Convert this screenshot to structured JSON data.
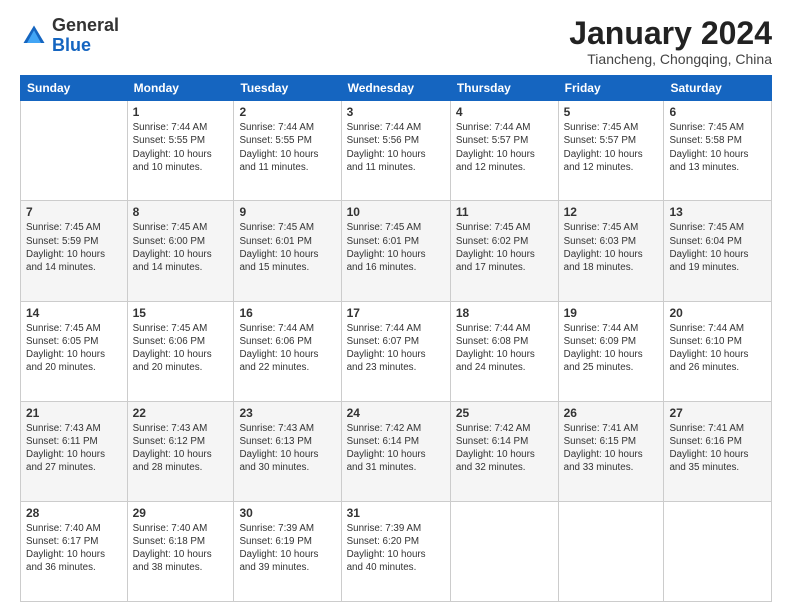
{
  "header": {
    "logo_general": "General",
    "logo_blue": "Blue",
    "month_title": "January 2024",
    "location": "Tiancheng, Chongqing, China"
  },
  "weekdays": [
    "Sunday",
    "Monday",
    "Tuesday",
    "Wednesday",
    "Thursday",
    "Friday",
    "Saturday"
  ],
  "weeks": [
    [
      {
        "day": "",
        "info": ""
      },
      {
        "day": "1",
        "info": "Sunrise: 7:44 AM\nSunset: 5:55 PM\nDaylight: 10 hours\nand 10 minutes."
      },
      {
        "day": "2",
        "info": "Sunrise: 7:44 AM\nSunset: 5:55 PM\nDaylight: 10 hours\nand 11 minutes."
      },
      {
        "day": "3",
        "info": "Sunrise: 7:44 AM\nSunset: 5:56 PM\nDaylight: 10 hours\nand 11 minutes."
      },
      {
        "day": "4",
        "info": "Sunrise: 7:44 AM\nSunset: 5:57 PM\nDaylight: 10 hours\nand 12 minutes."
      },
      {
        "day": "5",
        "info": "Sunrise: 7:45 AM\nSunset: 5:57 PM\nDaylight: 10 hours\nand 12 minutes."
      },
      {
        "day": "6",
        "info": "Sunrise: 7:45 AM\nSunset: 5:58 PM\nDaylight: 10 hours\nand 13 minutes."
      }
    ],
    [
      {
        "day": "7",
        "info": "Sunrise: 7:45 AM\nSunset: 5:59 PM\nDaylight: 10 hours\nand 14 minutes."
      },
      {
        "day": "8",
        "info": "Sunrise: 7:45 AM\nSunset: 6:00 PM\nDaylight: 10 hours\nand 14 minutes."
      },
      {
        "day": "9",
        "info": "Sunrise: 7:45 AM\nSunset: 6:01 PM\nDaylight: 10 hours\nand 15 minutes."
      },
      {
        "day": "10",
        "info": "Sunrise: 7:45 AM\nSunset: 6:01 PM\nDaylight: 10 hours\nand 16 minutes."
      },
      {
        "day": "11",
        "info": "Sunrise: 7:45 AM\nSunset: 6:02 PM\nDaylight: 10 hours\nand 17 minutes."
      },
      {
        "day": "12",
        "info": "Sunrise: 7:45 AM\nSunset: 6:03 PM\nDaylight: 10 hours\nand 18 minutes."
      },
      {
        "day": "13",
        "info": "Sunrise: 7:45 AM\nSunset: 6:04 PM\nDaylight: 10 hours\nand 19 minutes."
      }
    ],
    [
      {
        "day": "14",
        "info": "Sunrise: 7:45 AM\nSunset: 6:05 PM\nDaylight: 10 hours\nand 20 minutes."
      },
      {
        "day": "15",
        "info": "Sunrise: 7:45 AM\nSunset: 6:06 PM\nDaylight: 10 hours\nand 20 minutes."
      },
      {
        "day": "16",
        "info": "Sunrise: 7:44 AM\nSunset: 6:06 PM\nDaylight: 10 hours\nand 22 minutes."
      },
      {
        "day": "17",
        "info": "Sunrise: 7:44 AM\nSunset: 6:07 PM\nDaylight: 10 hours\nand 23 minutes."
      },
      {
        "day": "18",
        "info": "Sunrise: 7:44 AM\nSunset: 6:08 PM\nDaylight: 10 hours\nand 24 minutes."
      },
      {
        "day": "19",
        "info": "Sunrise: 7:44 AM\nSunset: 6:09 PM\nDaylight: 10 hours\nand 25 minutes."
      },
      {
        "day": "20",
        "info": "Sunrise: 7:44 AM\nSunset: 6:10 PM\nDaylight: 10 hours\nand 26 minutes."
      }
    ],
    [
      {
        "day": "21",
        "info": "Sunrise: 7:43 AM\nSunset: 6:11 PM\nDaylight: 10 hours\nand 27 minutes."
      },
      {
        "day": "22",
        "info": "Sunrise: 7:43 AM\nSunset: 6:12 PM\nDaylight: 10 hours\nand 28 minutes."
      },
      {
        "day": "23",
        "info": "Sunrise: 7:43 AM\nSunset: 6:13 PM\nDaylight: 10 hours\nand 30 minutes."
      },
      {
        "day": "24",
        "info": "Sunrise: 7:42 AM\nSunset: 6:14 PM\nDaylight: 10 hours\nand 31 minutes."
      },
      {
        "day": "25",
        "info": "Sunrise: 7:42 AM\nSunset: 6:14 PM\nDaylight: 10 hours\nand 32 minutes."
      },
      {
        "day": "26",
        "info": "Sunrise: 7:41 AM\nSunset: 6:15 PM\nDaylight: 10 hours\nand 33 minutes."
      },
      {
        "day": "27",
        "info": "Sunrise: 7:41 AM\nSunset: 6:16 PM\nDaylight: 10 hours\nand 35 minutes."
      }
    ],
    [
      {
        "day": "28",
        "info": "Sunrise: 7:40 AM\nSunset: 6:17 PM\nDaylight: 10 hours\nand 36 minutes."
      },
      {
        "day": "29",
        "info": "Sunrise: 7:40 AM\nSunset: 6:18 PM\nDaylight: 10 hours\nand 38 minutes."
      },
      {
        "day": "30",
        "info": "Sunrise: 7:39 AM\nSunset: 6:19 PM\nDaylight: 10 hours\nand 39 minutes."
      },
      {
        "day": "31",
        "info": "Sunrise: 7:39 AM\nSunset: 6:20 PM\nDaylight: 10 hours\nand 40 minutes."
      },
      {
        "day": "",
        "info": ""
      },
      {
        "day": "",
        "info": ""
      },
      {
        "day": "",
        "info": ""
      }
    ]
  ]
}
